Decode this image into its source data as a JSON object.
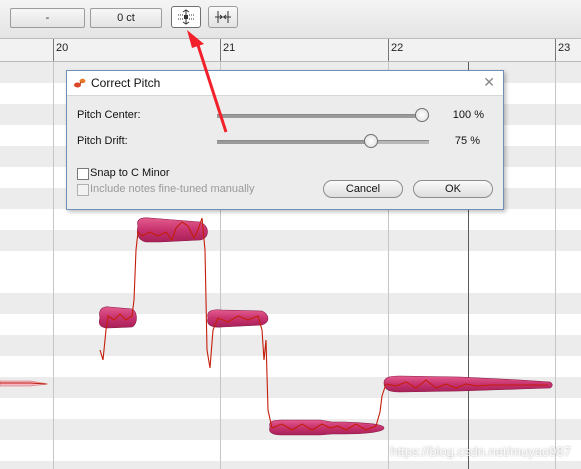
{
  "toolbar": {
    "field1_value": "-",
    "field2_value": "0 ct",
    "correct_pitch_icon": "correct-pitch-icon",
    "quantize_time_icon": "quantize-time-icon"
  },
  "ruler": {
    "bars": [
      "20",
      "21",
      "22",
      "23"
    ]
  },
  "dialog": {
    "title": "Correct Pitch",
    "pitch_center": {
      "label": "Pitch Center:",
      "value_text": "100 %",
      "level": 1.0
    },
    "pitch_drift": {
      "label": "Pitch Drift:",
      "value_text": "75 %",
      "level": 0.75
    },
    "snap_label": "Snap to C Minor",
    "snap_checked": false,
    "include_label": "Include notes fine-tuned manually",
    "include_checked": false,
    "include_disabled": true,
    "cancel_label": "Cancel",
    "ok_label": "OK"
  },
  "colors": {
    "note_fill": "#c8336e",
    "note_highlight": "#e35c8f",
    "pitch_curve": "#c41e0a",
    "arrow": "#f2202a",
    "dialog_border": "#6e8fb6"
  },
  "watermark": "https://blog.csdn.net/muyao987"
}
